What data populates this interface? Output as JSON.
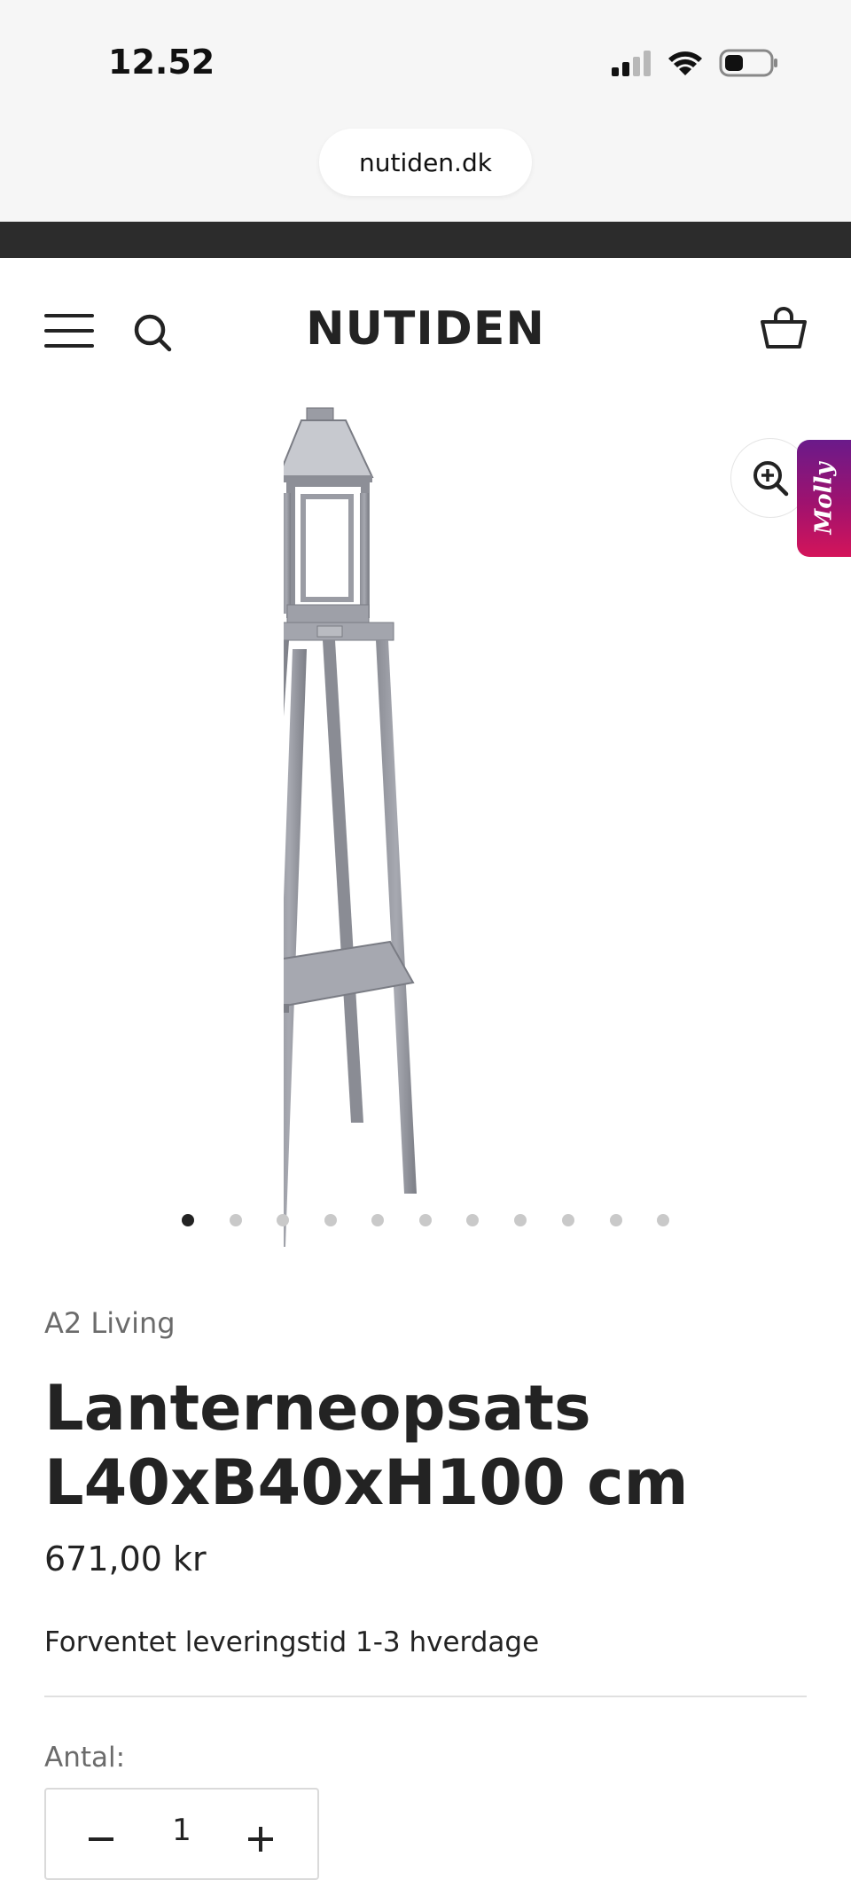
{
  "status_bar": {
    "time": "12.52",
    "icons": [
      "signal-icon",
      "wifi-icon",
      "battery-icon"
    ]
  },
  "browser": {
    "url": "nutiden.dk"
  },
  "header": {
    "logo": "NUTIDEN",
    "icons": [
      "menu-icon",
      "search-icon",
      "cart-icon"
    ]
  },
  "gallery": {
    "image_subject": "lantern on metal stand",
    "zoom_icon": "zoom-in-icon",
    "chat_tab_label": "Molly",
    "dots_total": 11,
    "active_dot_index": 0
  },
  "product": {
    "vendor": "A2 Living",
    "title_line1": "Lanterneopsats",
    "title_line2": "L40xB40xH100 cm",
    "price": "671,00 kr",
    "delivery": "Forventet leveringstid 1-3 hverdage",
    "quantity_label": "Antal:",
    "quantity": "1"
  },
  "colors": {
    "announcement_bar": "#2c2c2c",
    "text": "#232323",
    "molly_gradient_start": "#6a1a8a",
    "molly_gradient_end": "#d4145a"
  }
}
